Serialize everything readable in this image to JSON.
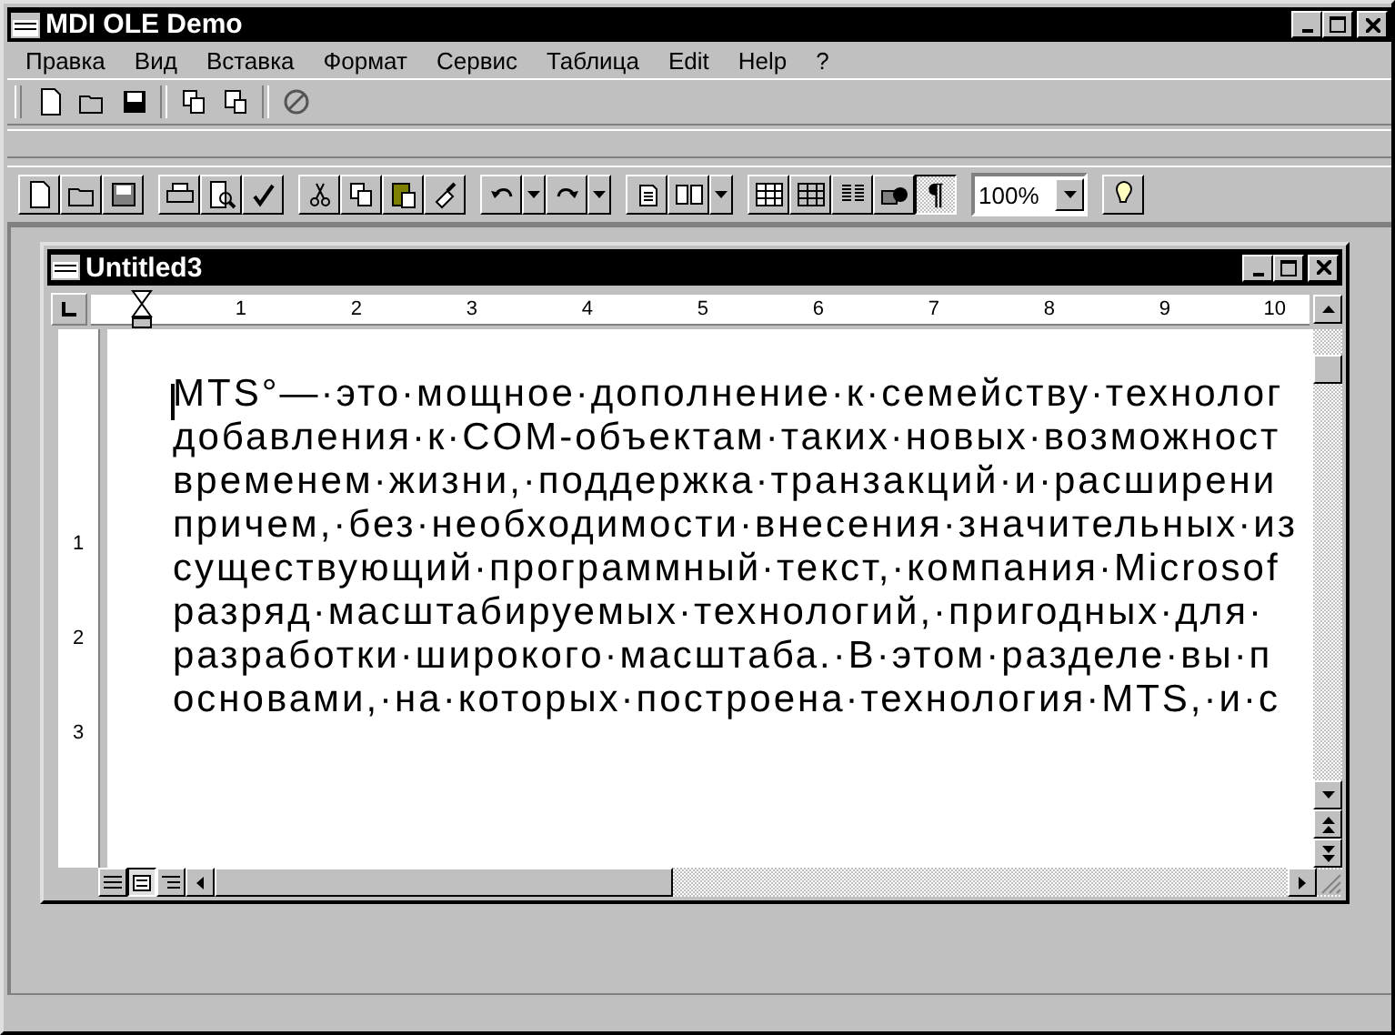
{
  "window": {
    "title": "MDI OLE Demo"
  },
  "menu": [
    "Правка",
    "Вид",
    "Вставка",
    "Формат",
    "Сервис",
    "Таблица",
    "Edit",
    "Help",
    "?"
  ],
  "standard_toolbar": {
    "paragraph_marks": {
      "glyph": "¶",
      "pressed": true
    },
    "zoom": {
      "value": "100%"
    }
  },
  "document_window": {
    "title": "Untitled3",
    "ruler_labels": [
      "1",
      "2",
      "3",
      "4",
      "5",
      "6",
      "7",
      "8",
      "9",
      "10"
    ],
    "vertical_ruler_labels": [
      "1",
      "2",
      "3"
    ],
    "lines": [
      "MTS°—·это·мощное·дополнение·к·семейству·технолог",
      "добавления·к·COM-объектам·таких·новых·возможност",
      "временем·жизни,·поддержка·транзакций·и·расширени",
      "причем,·без·необходимости·внесения·значительных·из",
      "существующий·программный·текст,·компания·Microsof",
      "разряд·масштабируемых·технологий,·пригодных·для·",
      "разработки·широкого·масштаба.·В·этом·разделе·вы·п",
      "основами,·на·которых·построена·технология·MTS,·и·с"
    ]
  }
}
